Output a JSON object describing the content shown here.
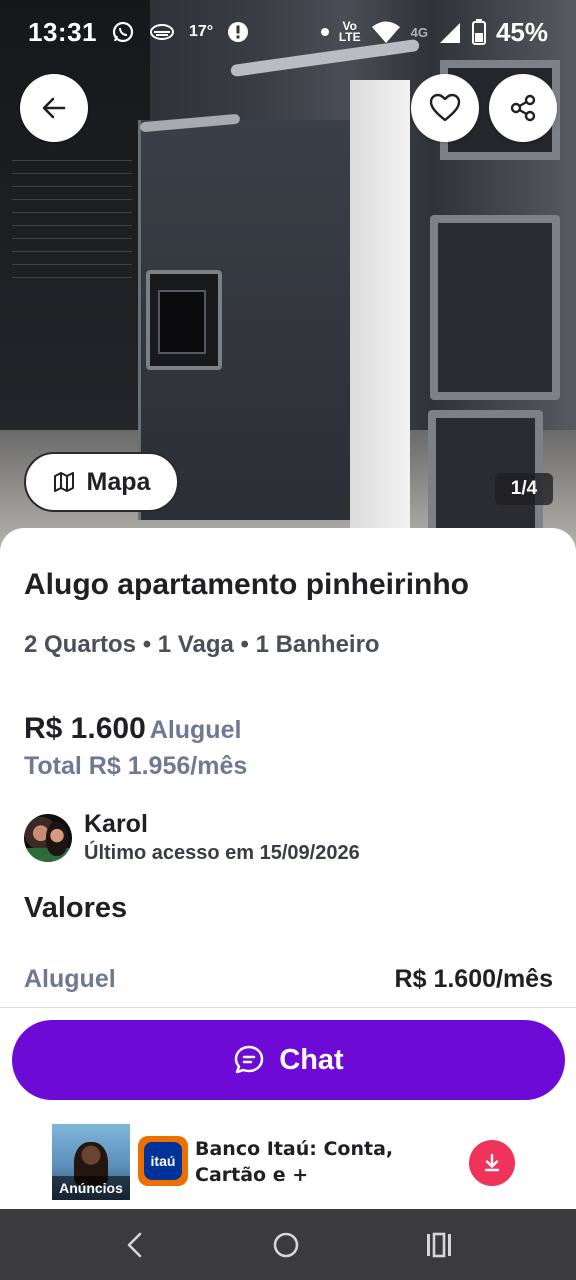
{
  "status_bar": {
    "time": "13:31",
    "temperature": "17°",
    "network_label_top": "Vo",
    "network_label_bottom": "LTE",
    "network_type": "4G",
    "battery": "45%",
    "icons": [
      "whatsapp-icon",
      "weather-icon",
      "alert-icon",
      "dot-icon",
      "wifi-icon",
      "signal-icon",
      "battery-icon"
    ]
  },
  "gallery": {
    "counter": "1/4",
    "map_button_label": "Mapa"
  },
  "listing": {
    "title": "Alugo apartamento pinheirinho",
    "features": "2 Quartos • 1 Vaga • 1 Banheiro",
    "price": "R$ 1.600",
    "price_label": "Aluguel",
    "total": "Total R$ 1.956/mês"
  },
  "seller": {
    "name": "Karol",
    "last_seen": "Último acesso em 15/09/2026"
  },
  "values_section": {
    "heading": "Valores",
    "rows": [
      {
        "label": "Aluguel",
        "value": "R$ 1.600/mês"
      }
    ]
  },
  "actions": {
    "chat_label": "Chat"
  },
  "ad": {
    "badge": "Anúncios",
    "logo_text": "itaú",
    "line1": "Banco Itaú: Conta,",
    "line2": "Cartão e +"
  },
  "colors": {
    "primary": "#6e0ad6",
    "muted_text": "#6f7894",
    "ad_download": "#f0335b",
    "itau_orange": "#ec7000",
    "itau_blue": "#003399"
  }
}
